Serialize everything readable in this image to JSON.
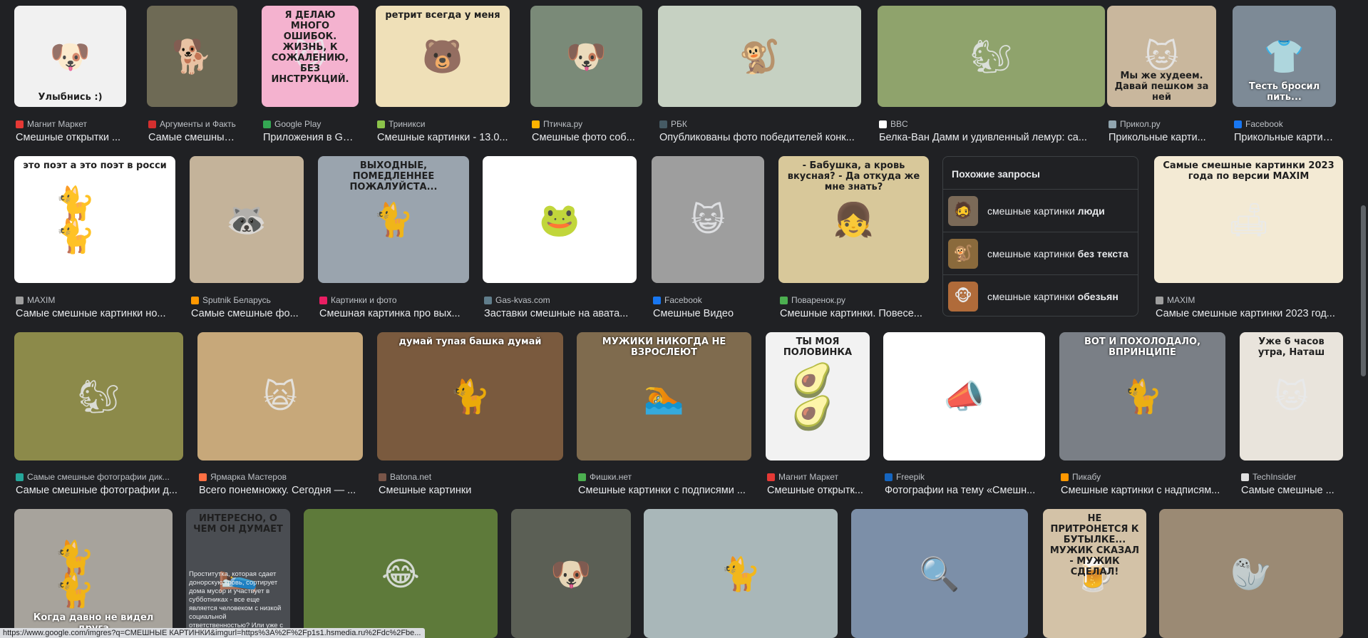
{
  "status_url": "https://www.google.com/imgres?q=СМЕШНЫЕ КАРТИНКИ&imgurl=https%3A%2F%2Fp1s1.hsmedia.ru%2Fdc%2Fbe...",
  "row1": [
    {
      "source": "Магнит Маркет",
      "title": "Смешные открытки ...",
      "fav": "#e53935",
      "bg": "#f1f1f1",
      "glyph": "🐶",
      "caption": "Улыбнись :)",
      "cap_pos": "bottom",
      "cap_style": "dark"
    },
    {
      "source": "Аргументы и Факты",
      "title": "Самые смешные ...",
      "fav": "#d32f2f",
      "bg": "#6e6a55",
      "glyph": "🐕",
      "caption": "",
      "cap_pos": "bottom",
      "cap_style": "light"
    },
    {
      "source": "Google Play",
      "title": "Приложения в Go...",
      "fav": "#34a853",
      "bg": "#f4b2cf",
      "glyph": "😼",
      "caption": "Я ДЕЛАЮ МНОГО ОШИБОК. ЖИЗНЬ, К СОЖАЛЕНИЮ, БЕЗ ИНСТРУКЦИЙ.",
      "cap_pos": "top",
      "cap_style": "dark"
    },
    {
      "source": "Триникси",
      "title": "Смешные картинки - 13.0...",
      "fav": "#8bc34a",
      "bg": "#efe0b8",
      "glyph": "🐻",
      "caption": "ретрит всегда у меня",
      "cap_pos": "top",
      "cap_style": "dark"
    },
    {
      "source": "Птичка.ру",
      "title": "Смешные фото соб...",
      "fav": "#ffb300",
      "bg": "#7a8a78",
      "glyph": "🐶",
      "caption": "",
      "cap_pos": "bottom",
      "cap_style": "light"
    },
    {
      "source": "РБК",
      "title": "Опубликованы фото победителей конк...",
      "fav": "#455a64",
      "bg": "#c6d1c2",
      "glyph": "🐒",
      "caption": "",
      "cap_pos": "bottom",
      "cap_style": "light"
    },
    {
      "source": "BBC",
      "title": "Белка-Ван Дамм и удивленный лемур: са...",
      "fav": "#ffffff",
      "bg": "#8fa36c",
      "glyph": "🐿",
      "caption": "",
      "cap_pos": "bottom",
      "cap_style": "light"
    },
    {
      "source": "Прикол.ру",
      "title": "Прикольные карти...",
      "fav": "#90a4ae",
      "bg": "#c9b79d",
      "glyph": "🐱",
      "caption": "Мы же худеем. Давай пешком за ней",
      "cap_pos": "bottom",
      "cap_style": "dark"
    },
    {
      "source": "Facebook",
      "title": "Прикольные картин...",
      "fav": "#1877f2",
      "bg": "#7d8a96",
      "glyph": "👕",
      "caption": "Тесть бросил пить...",
      "cap_pos": "bottom",
      "cap_style": "light"
    }
  ],
  "row2": [
    {
      "source": "MAXIM",
      "title": "Самые смешные картинки но...",
      "fav": "#9e9e9e",
      "bg": "#ffffff",
      "glyph": "🐈 🐈",
      "caption": "это поэт   а это поэт в росси",
      "cap_pos": "top",
      "cap_style": "dark"
    },
    {
      "source": "Sputnik Беларусь",
      "title": "Самые смешные фо...",
      "fav": "#ff9800",
      "bg": "#c4b39a",
      "glyph": "🦝",
      "caption": "",
      "cap_pos": "bottom",
      "cap_style": "light"
    },
    {
      "source": "Картинки и фото",
      "title": "Смешная картинка про вых...",
      "fav": "#e91e63",
      "bg": "#9aa4ae",
      "glyph": "🐈",
      "caption": "ВЫХОДНЫЕ, ПОМЕДЛЕННЕЕ ПОЖАЛУЙСТА...",
      "cap_pos": "top",
      "cap_style": "dark"
    },
    {
      "source": "Gas-kvas.com",
      "title": "Заставки смешные на авата...",
      "fav": "#607d8b",
      "bg": "#ffffff",
      "glyph": "🐸",
      "caption": "",
      "cap_pos": "bottom",
      "cap_style": "light"
    },
    {
      "source": "Facebook",
      "title": "Смешные Видео",
      "fav": "#1877f2",
      "bg": "#9e9e9e",
      "glyph": "😺",
      "caption": "",
      "cap_pos": "bottom",
      "cap_style": "light"
    },
    {
      "source": "Поваренок.ру",
      "title": "Смешные картинки. Повесе...",
      "fav": "#4caf50",
      "bg": "#d8c89a",
      "glyph": "👧",
      "caption": "- Бабушка, а кровь вкусная? - Да откуда же мне знать?",
      "cap_pos": "top",
      "cap_style": "dark"
    },
    {
      "source": "MAXIM",
      "title": "Самые смешные картинки 2023 год...",
      "fav": "#9e9e9e",
      "bg": "#f3ead4",
      "glyph": "🛋",
      "caption": "Самые смешные картинки 2023 года по версии MAXIM",
      "cap_pos": "top",
      "cap_style": "dark"
    }
  ],
  "related": {
    "heading": "Похожие запросы",
    "items": [
      {
        "prefix": "смешные картинки ",
        "bold": "люди",
        "bg": "#7b6a58",
        "glyph": "🧔"
      },
      {
        "prefix": "смешные картинки ",
        "bold": "без текста",
        "bg": "#8a6a3c",
        "glyph": "🐒"
      },
      {
        "prefix": "смешные картинки ",
        "bold": "обезьян",
        "bg": "#b06b3a",
        "glyph": "🐵"
      }
    ]
  },
  "row3": [
    {
      "source": "Самые смешные фотографии дик...",
      "title": "Самые смешные фотографии д...",
      "fav": "#26a69a",
      "bg": "#8c8a4a",
      "glyph": "🐿",
      "caption": "",
      "cap_pos": "bottom",
      "cap_style": "light"
    },
    {
      "source": "Ярмарка Мастеров",
      "title": "Всего понемножку. Сегодня — ...",
      "fav": "#ff7043",
      "bg": "#c7a87a",
      "glyph": "🙀",
      "caption": "",
      "cap_pos": "bottom",
      "cap_style": "light"
    },
    {
      "source": "Batona.net",
      "title": "Смешные картинки",
      "fav": "#795548",
      "bg": "#7a5a3e",
      "glyph": "🐈",
      "caption": "думай тупая башка думай",
      "cap_pos": "top",
      "cap_style": "light"
    },
    {
      "source": "Фишки.нет",
      "title": "Смешные картинки с подписями ...",
      "fav": "#4caf50",
      "bg": "#7f6b4e",
      "glyph": "🏊",
      "caption": "МУЖИКИ НИКОГДА НЕ ВЗРОСЛЕЮТ",
      "cap_pos": "top",
      "cap_style": "light"
    },
    {
      "source": "Магнит Маркет",
      "title": "Смешные открытк...",
      "fav": "#e53935",
      "bg": "#f2f2f2",
      "glyph": "🥑🥑",
      "caption": "ТЫ МОЯ ПОЛОВИНКА",
      "cap_pos": "top",
      "cap_style": "dark"
    },
    {
      "source": "Freepik",
      "title": "Фотографии на тему «Смешн...",
      "fav": "#1565c0",
      "bg": "#ffffff",
      "glyph": "📣",
      "caption": "",
      "cap_pos": "bottom",
      "cap_style": "light"
    },
    {
      "source": "Пикабу",
      "title": "Смешные картинки с надписям...",
      "fav": "#ff9800",
      "bg": "#7a7f86",
      "glyph": "🐈",
      "caption": "ВОТ И ПОХОЛОДАЛО, ВПРИНЦИПЕ",
      "cap_pos": "top",
      "cap_style": "light"
    },
    {
      "source": "TechInsider",
      "title": "Самые смешные ...",
      "fav": "#e0e0e0",
      "bg": "#e9e4dc",
      "glyph": "🐱",
      "caption": "Уже 6 часов утра, Наташ",
      "cap_pos": "top",
      "cap_style": "dark"
    }
  ],
  "row4": [
    {
      "bg": "#a7a39c",
      "glyph": "🐈🐈",
      "caption": "Когда давно не видел друга",
      "cap_pos": "bottom",
      "cap_style": "light"
    },
    {
      "bg": "#4a4d52",
      "glyph": "🛌",
      "caption": "ИНТЕРЕСНО, О ЧЕМ ОН ДУМАЕТ",
      "cap_pos": "top",
      "cap_style": "dark"
    },
    {
      "bg": "#5e7a3a",
      "glyph": "😂",
      "caption": "",
      "cap_pos": "bottom",
      "cap_style": "light"
    },
    {
      "bg": "#5b5f55",
      "glyph": "🐶",
      "caption": "",
      "cap_pos": "bottom",
      "cap_style": "light"
    },
    {
      "bg": "#a9b7b9",
      "glyph": "🐈",
      "caption": "",
      "cap_pos": "bottom",
      "cap_style": "light"
    },
    {
      "bg": "#7c8fa8",
      "glyph": "🔍",
      "caption": "",
      "cap_pos": "bottom",
      "cap_style": "light"
    },
    {
      "bg": "#d3c2a7",
      "glyph": "🍺",
      "caption": "НЕ ПРИТРОНЕТСЯ К БУТЫЛКЕ... МУЖИК СКАЗАЛ - МУЖИК СДЕЛАЛ!",
      "cap_pos": "top",
      "cap_style": "dark"
    },
    {
      "bg": "#9b8a74",
      "glyph": "🦭",
      "caption": "",
      "cap_pos": "bottom",
      "cap_style": "light"
    }
  ],
  "row4_overlay_text": "Проститутка, которая сдает донорскую кровь, сортирует дома мусор и участвует в субботниках - все еще является человеком с низкой социальной ответственностью? Или уже с повышенной? Или вышла в ноль?"
}
